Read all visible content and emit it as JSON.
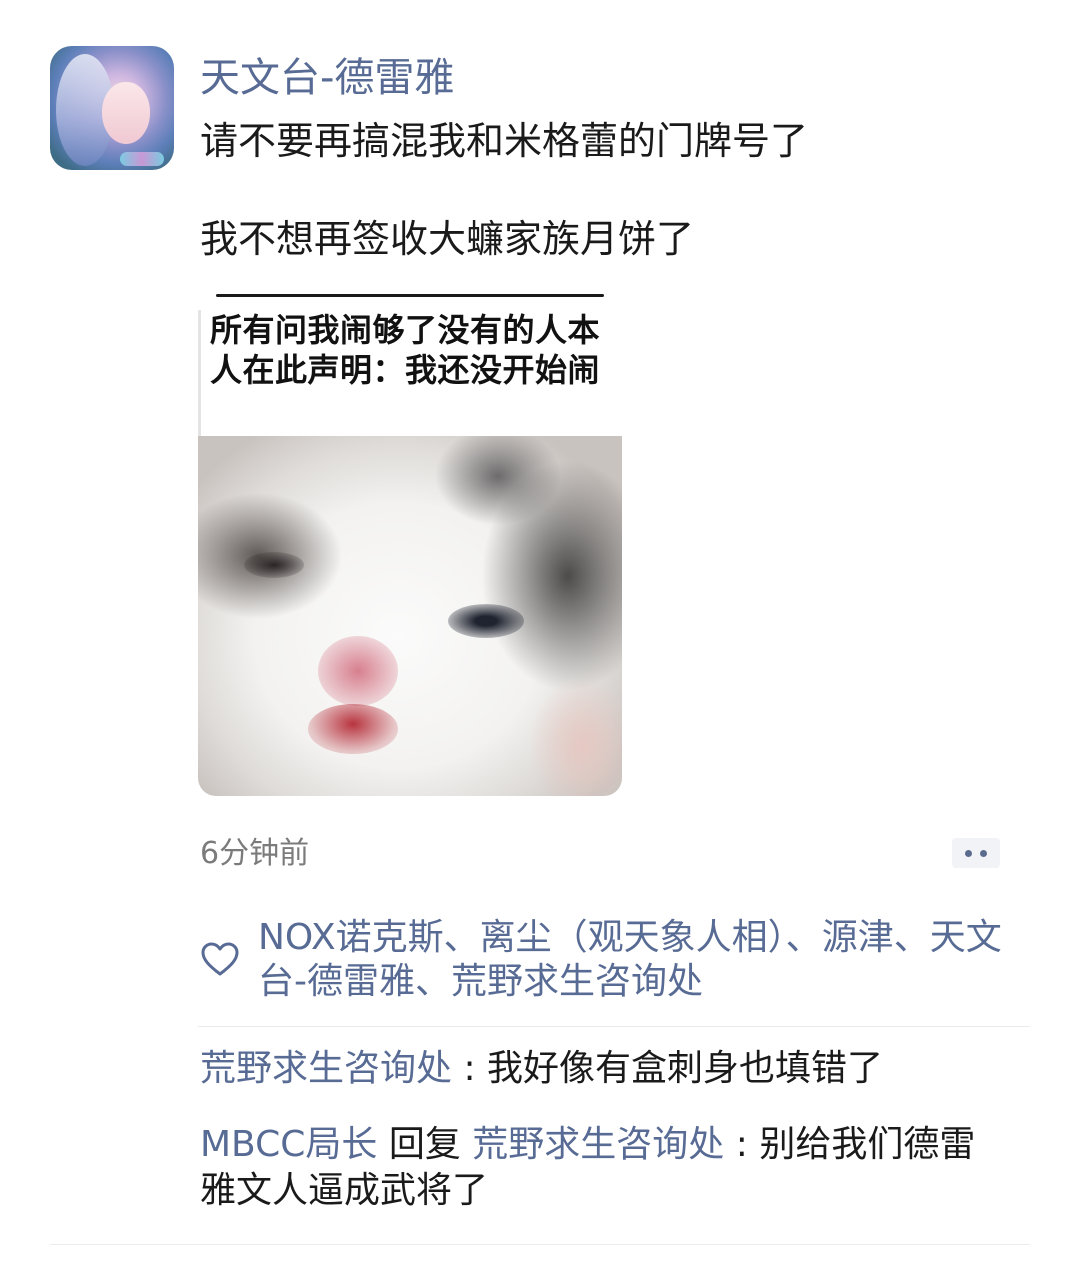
{
  "post": {
    "username": "天文台-德雷雅",
    "text_line1": "请不要再搞混我和米格蕾的门牌号了",
    "text_line2": "我不想再签收大蠊家族月饼了",
    "meme_caption": "所有问我闹够了没有的人本人在此声明：我还没开始闹",
    "timestamp": "6分钟前"
  },
  "likes": {
    "names": [
      "NOX诺克斯",
      "离尘（观天象人相）",
      "源津",
      "天文台-德雷雅",
      "荒野求生咨询处"
    ],
    "separator": "、"
  },
  "comments": [
    {
      "author": "荒野求生咨询处",
      "reply_word": "",
      "reply_to": "",
      "sep": " : ",
      "text": "我好像有盒刺身也填错了"
    },
    {
      "author": "MBCC局长",
      "reply_word": " 回复 ",
      "reply_to": "荒野求生咨询处",
      "sep": " : ",
      "text": "别给我们德雷雅文人逼成武将了"
    }
  ],
  "icons": {
    "more": "more-dots-icon",
    "like": "heart-outline-icon"
  },
  "colors": {
    "link_name": "#586b94",
    "timestamp": "#7b7b7b",
    "text": "#1a1a1a"
  }
}
